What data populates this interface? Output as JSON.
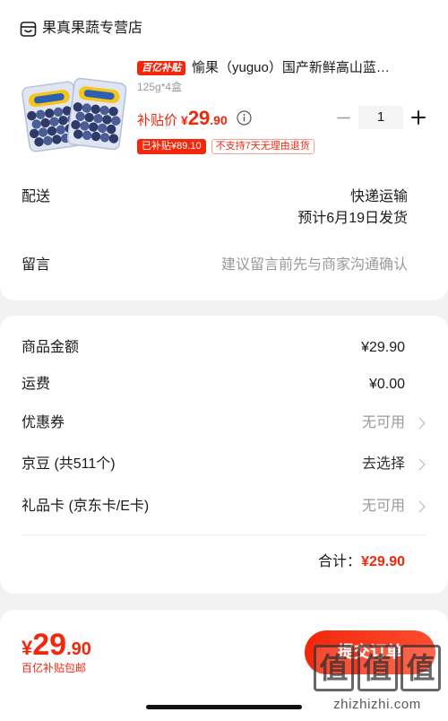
{
  "colors": {
    "accent": "#f2270c",
    "text": "#1a1a1a",
    "muted": "#999999",
    "page_background": "#f2f2f2"
  },
  "store": {
    "name": "果真果蔬专营店"
  },
  "product": {
    "badge": "百亿补贴",
    "title": "愉果（yuguo）国产新鲜高山蓝…",
    "spec": "125g*4盒",
    "price_label": "补贴价",
    "price": {
      "symbol": "¥",
      "integer": "29",
      "decimal": ".90"
    },
    "quantity": "1",
    "tags": [
      "已补贴¥89.10",
      "不支持7天无理由退货"
    ]
  },
  "delivery": {
    "label": "配送",
    "method": "快递运输",
    "eta": "预计6月19日发货"
  },
  "message": {
    "label": "留言",
    "placeholder": "建议留言前先与商家沟通确认"
  },
  "summary": {
    "rows": [
      {
        "label": "商品金额",
        "value": "¥29.90"
      },
      {
        "label": "运费",
        "value": "¥0.00"
      },
      {
        "label": "优惠券",
        "value": "无可用"
      },
      {
        "label": "京豆 (共511个)",
        "value": "去选择"
      },
      {
        "label": "礼品卡 (京东卡/E卡)",
        "value": "无可用"
      }
    ],
    "total_label": "合计：",
    "total_value": "¥29.90"
  },
  "footer": {
    "price": {
      "symbol": "¥",
      "integer": "29",
      "decimal": ".90"
    },
    "note": "百亿补贴包邮",
    "submit_label": "提交订单"
  },
  "watermark": {
    "glyphs": [
      "值",
      "值",
      "值"
    ],
    "site": "zhizhizhi.com"
  }
}
